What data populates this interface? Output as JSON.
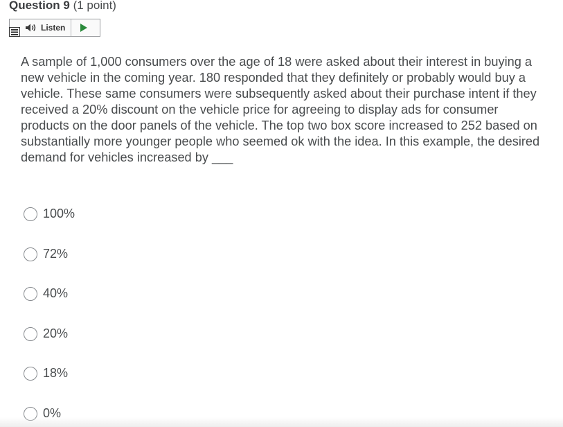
{
  "question": {
    "title": "Question 9",
    "points": "(1 point)"
  },
  "listen": {
    "label": "Listen",
    "menu_icon": "menu-icon",
    "speaker_icon": "speaker-icon",
    "play_icon": "play-icon"
  },
  "body": {
    "text": "A sample of 1,000 consumers over the age of 18 were asked about their interest in buying a new vehicle in the coming year. 180 responded that they definitely or probably would buy a vehicle. These same consumers were subsequently asked about their purchase intent if they received a 20% discount on the vehicle price for agreeing to display ads for consumer products on the door panels of the vehicle.  The top two box score increased to 252 based on substantially more younger people who seemed ok with the idea. In this example, the desired demand for vehicles increased by ___"
  },
  "options": [
    {
      "label": "100%"
    },
    {
      "label": "72%"
    },
    {
      "label": "40%"
    },
    {
      "label": "20%"
    },
    {
      "label": "18%"
    },
    {
      "label": "0%"
    }
  ],
  "colors": {
    "play": "#2a8a3a",
    "text": "#494c4e",
    "border": "#9a9ca0"
  }
}
